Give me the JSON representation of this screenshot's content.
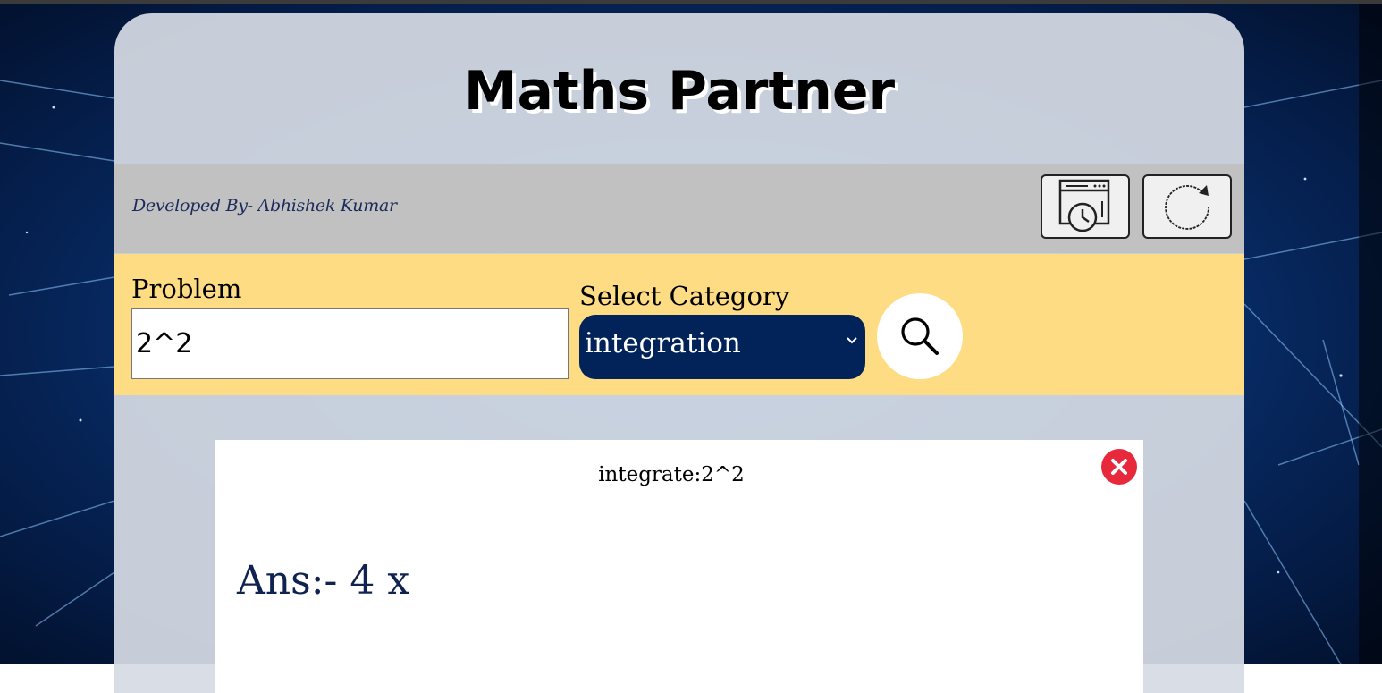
{
  "app": {
    "title": "Maths Partner",
    "developer_credit": "Developed By- Abhishek Kumar"
  },
  "toolbar": {
    "history_icon": "history-icon",
    "refresh_icon": "refresh-icon"
  },
  "form": {
    "problem_label": "Problem",
    "problem_value": "2^2",
    "category_label": "Select Category",
    "category_selected": "integration",
    "search_icon": "search-icon"
  },
  "result": {
    "query": "integrate:2^2",
    "answer": "Ans:- 4 x",
    "close_icon": "close-icon"
  },
  "colors": {
    "input_bar": "#fddc83",
    "select_bg": "#02235a",
    "answer_text": "#0f2250",
    "close_red": "#e8293b"
  }
}
